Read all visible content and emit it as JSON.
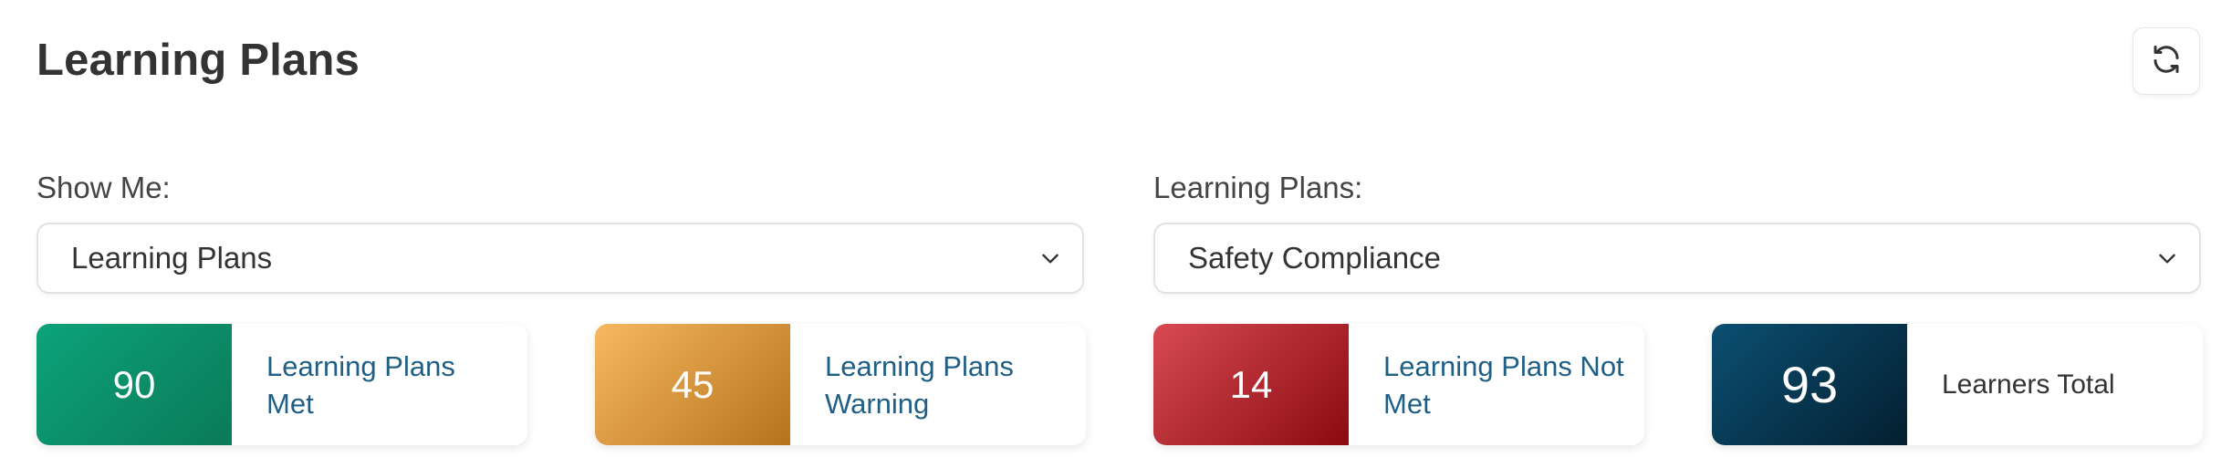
{
  "header": {
    "title": "Learning Plans",
    "refresh_icon": "refresh-icon"
  },
  "filters": {
    "show_me": {
      "label": "Show Me:",
      "value": "Learning Plans"
    },
    "learning_plans": {
      "label": "Learning Plans:",
      "value": "Safety Compliance"
    }
  },
  "stats": [
    {
      "value": "90",
      "label": "Learning Plans Met",
      "color": "#0b8f68"
    },
    {
      "value": "45",
      "label": "Learning Plans Warning",
      "color": "#e0963c"
    },
    {
      "value": "14",
      "label": "Learning Plans Not Met",
      "color": "#b0232b"
    },
    {
      "value": "93",
      "label": "Learners Total",
      "color": "#063a55"
    }
  ]
}
